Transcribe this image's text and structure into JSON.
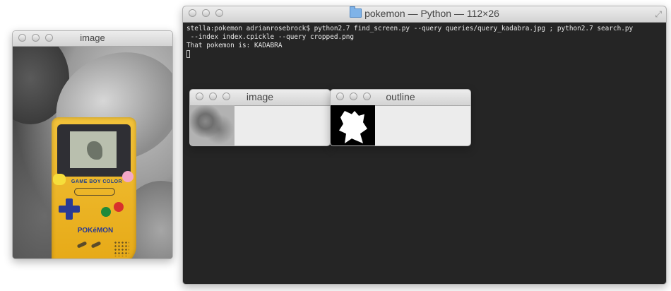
{
  "image_window": {
    "title": "image",
    "photo_brand_label": "GAME BOY COLOR",
    "photo_pokemon_label": "POKéMON"
  },
  "terminal_window": {
    "title": "pokemon — Python — 112×26",
    "lines": [
      "stella:pokemon adrianrosebrock$ python2.7 find_screen.py --query queries/query_kadabra.jpg ; python2.7 search.py",
      " --index index.cpickle --query cropped.png",
      "That pokemon is: KADABRA"
    ]
  },
  "query_window": {
    "title": "image"
  },
  "outline_window": {
    "title": "outline"
  }
}
